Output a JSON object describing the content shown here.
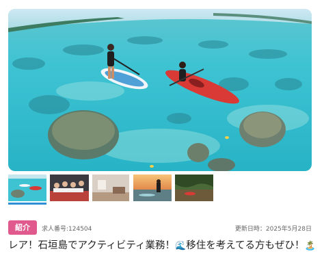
{
  "hero": {
    "icon": "hero-photo"
  },
  "gallery": {
    "thumbnails": [
      {
        "icon": "thumbnail-lagoon-kayak",
        "selected": true
      },
      {
        "icon": "thumbnail-staff-group",
        "selected": false
      },
      {
        "icon": "thumbnail-room-interior",
        "selected": false
      },
      {
        "icon": "thumbnail-sunset-sup",
        "selected": false
      },
      {
        "icon": "thumbnail-mangrove-canoe",
        "selected": false
      }
    ]
  },
  "listing": {
    "tag_label": "紹介",
    "job_number": "求人番号:124504",
    "updated": "更新日時：2025年5月28日",
    "title_main": "レア！石垣島でアクティビティ業務！",
    "title_emoji1": "🌊",
    "title_mid": "移住を考えてる方もぜひ！",
    "title_emoji2": "🏝️"
  },
  "colors": {
    "tag": "#e05a8e",
    "selected_bar": "#2e8fd9",
    "water": "#3fc7d4"
  }
}
